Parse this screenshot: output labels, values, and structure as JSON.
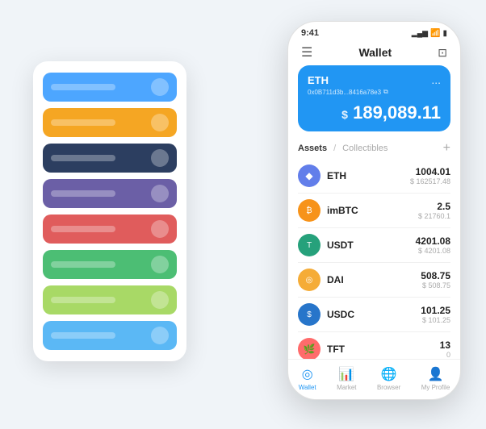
{
  "scene": {
    "background": "#f0f4f8"
  },
  "cardStack": {
    "cards": [
      {
        "color": "card-blue",
        "label": ""
      },
      {
        "color": "card-orange",
        "label": ""
      },
      {
        "color": "card-dark",
        "label": ""
      },
      {
        "color": "card-purple",
        "label": ""
      },
      {
        "color": "card-red",
        "label": ""
      },
      {
        "color": "card-green",
        "label": ""
      },
      {
        "color": "card-light-green",
        "label": ""
      },
      {
        "color": "card-light-blue",
        "label": ""
      }
    ]
  },
  "phone": {
    "statusBar": {
      "time": "9:41",
      "signal": "▂▄▆",
      "wifi": "WiFi",
      "battery": "🔋"
    },
    "nav": {
      "menuIcon": "☰",
      "title": "Wallet",
      "scanIcon": "⊡"
    },
    "ethCard": {
      "title": "ETH",
      "moreIcon": "...",
      "address": "0x0B711d3b...8416a78e3",
      "copyIcon": "⧉",
      "dollarSign": "$",
      "balance": "189,089.11"
    },
    "assetsSection": {
      "activeTab": "Assets",
      "separator": "/",
      "inactiveTab": "Collectibles",
      "addIcon": "+"
    },
    "assets": [
      {
        "symbol": "ETH",
        "iconLabel": "◆",
        "iconClass": "icon-eth",
        "amount": "1004.01",
        "usd": "$ 162517.48"
      },
      {
        "symbol": "imBTC",
        "iconLabel": "₿",
        "iconClass": "icon-imbtc",
        "amount": "2.5",
        "usd": "$ 21760.1"
      },
      {
        "symbol": "USDT",
        "iconLabel": "T",
        "iconClass": "icon-usdt",
        "amount": "4201.08",
        "usd": "$ 4201.08"
      },
      {
        "symbol": "DAI",
        "iconLabel": "◎",
        "iconClass": "icon-dai",
        "amount": "508.75",
        "usd": "$ 508.75"
      },
      {
        "symbol": "USDC",
        "iconLabel": "$",
        "iconClass": "icon-usdc",
        "amount": "101.25",
        "usd": "$ 101.25"
      },
      {
        "symbol": "TFT",
        "iconLabel": "🌿",
        "iconClass": "icon-tft",
        "amount": "13",
        "usd": "0"
      }
    ],
    "bottomNav": [
      {
        "label": "Wallet",
        "icon": "◎",
        "active": true
      },
      {
        "label": "Market",
        "icon": "📈",
        "active": false
      },
      {
        "label": "Browser",
        "icon": "🌐",
        "active": false
      },
      {
        "label": "My Profile",
        "icon": "👤",
        "active": false
      }
    ]
  }
}
